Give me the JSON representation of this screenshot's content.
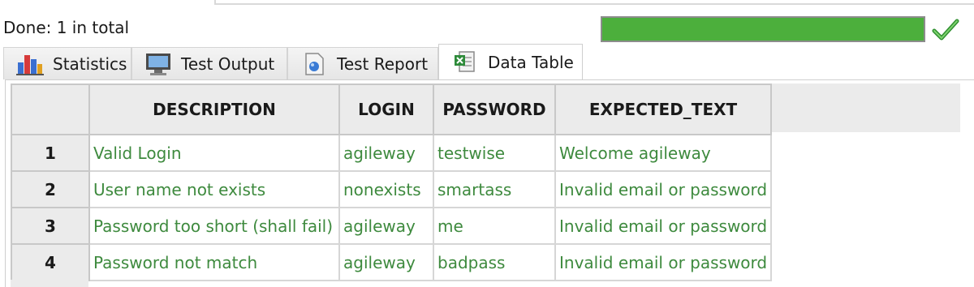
{
  "status": {
    "text": "Done: 1 in total",
    "progress_fraction": 1.0,
    "progress_color": "#4caf3c",
    "result_icon": "check-icon"
  },
  "tabs": [
    {
      "label": "Statistics",
      "icon": "bar-chart-icon",
      "active": false
    },
    {
      "label": "Test Output",
      "icon": "monitor-icon",
      "active": false
    },
    {
      "label": "Test Report",
      "icon": "report-icon",
      "active": false
    },
    {
      "label": "Data Table",
      "icon": "spreadsheet-icon",
      "active": true
    }
  ],
  "table": {
    "columns": [
      "DESCRIPTION",
      "LOGIN",
      "PASSWORD",
      "EXPECTED_TEXT"
    ],
    "rows": [
      {
        "num": "1",
        "cells": [
          "Valid Login",
          "agileway",
          "testwise",
          "Welcome agileway"
        ]
      },
      {
        "num": "2",
        "cells": [
          "User name not exists",
          "nonexists",
          "smartass",
          "Invalid email or password"
        ]
      },
      {
        "num": "3",
        "cells": [
          "Password too short (shall fail)",
          "agileway",
          "me",
          "Invalid email or password"
        ]
      },
      {
        "num": "4",
        "cells": [
          "Password not match",
          "agileway",
          "badpass",
          "Invalid email or password"
        ]
      }
    ],
    "cell_text_color": "#3e8a3e"
  }
}
